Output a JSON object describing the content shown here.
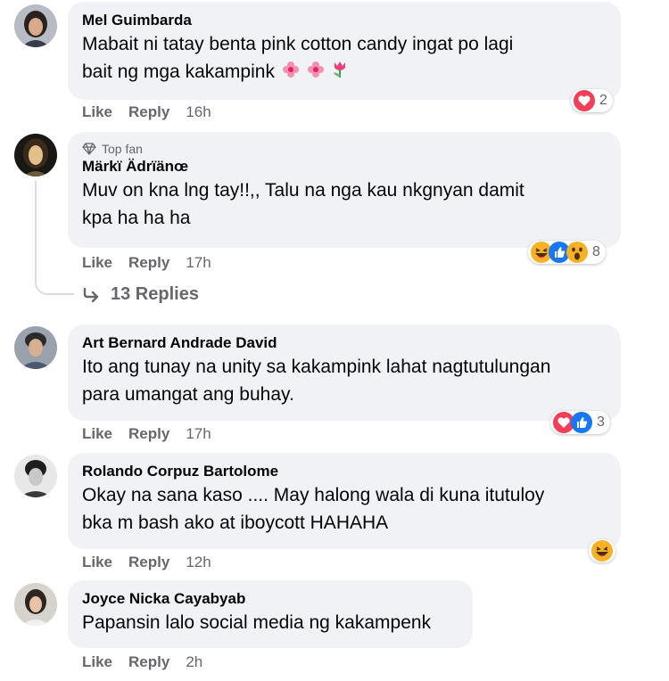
{
  "colors": {
    "bubble": "#f0f2f5",
    "meta": "#65676b",
    "love": "#f33e58",
    "like": "#1877f2",
    "haha": "#f7b125"
  },
  "comments": [
    {
      "name": "Mel Guimbarda",
      "lines": [
        "Mabait ni tatay benta pink cotton candy ingat po lagi",
        "bait ng mga kakampink"
      ],
      "inline_emojis": [
        "pink-flower-icon",
        "pink-flower-icon",
        "tulip-icon"
      ],
      "like": "Like",
      "reply": "Reply",
      "time": "16h",
      "reactions": [
        "love-reaction-icon"
      ],
      "reaction_count": "2"
    },
    {
      "badge": "Top fan",
      "name": "Märkï Ädrïänœ",
      "lines": [
        "Muv on kna lng tay!!,, Talu na nga kau nkgnyan damit",
        "kpa ha ha ha"
      ],
      "like": "Like",
      "reply": "Reply",
      "time": "17h",
      "reactions": [
        "haha-reaction-icon",
        "like-reaction-icon",
        "wow-reaction-icon"
      ],
      "reaction_count": "8"
    },
    {
      "name": "Art Bernard Andrade David",
      "lines": [
        "Ito ang tunay na unity sa kakampink lahat nagtutulungan",
        "para umangat ang buhay."
      ],
      "like": "Like",
      "reply": "Reply",
      "time": "17h",
      "reactions": [
        "love-reaction-icon",
        "like-reaction-icon"
      ],
      "reaction_count": "3"
    },
    {
      "name": "Rolando Corpuz Bartolome",
      "lines": [
        "Okay na sana kaso .... May halong wala di kuna itutuloy",
        "bka m bash ako at iboycott HAHAHA"
      ],
      "like": "Like",
      "reply": "Reply",
      "time": "12h",
      "reactions": [
        "haha-reaction-icon"
      ],
      "reaction_count": ""
    },
    {
      "name": "Joyce Nicka Cayabyab",
      "lines": [
        "Papansin lalo social media ng kakampenk"
      ],
      "like": "Like",
      "reply": "Reply",
      "time": "2h"
    }
  ],
  "replies_link": "13 Replies"
}
